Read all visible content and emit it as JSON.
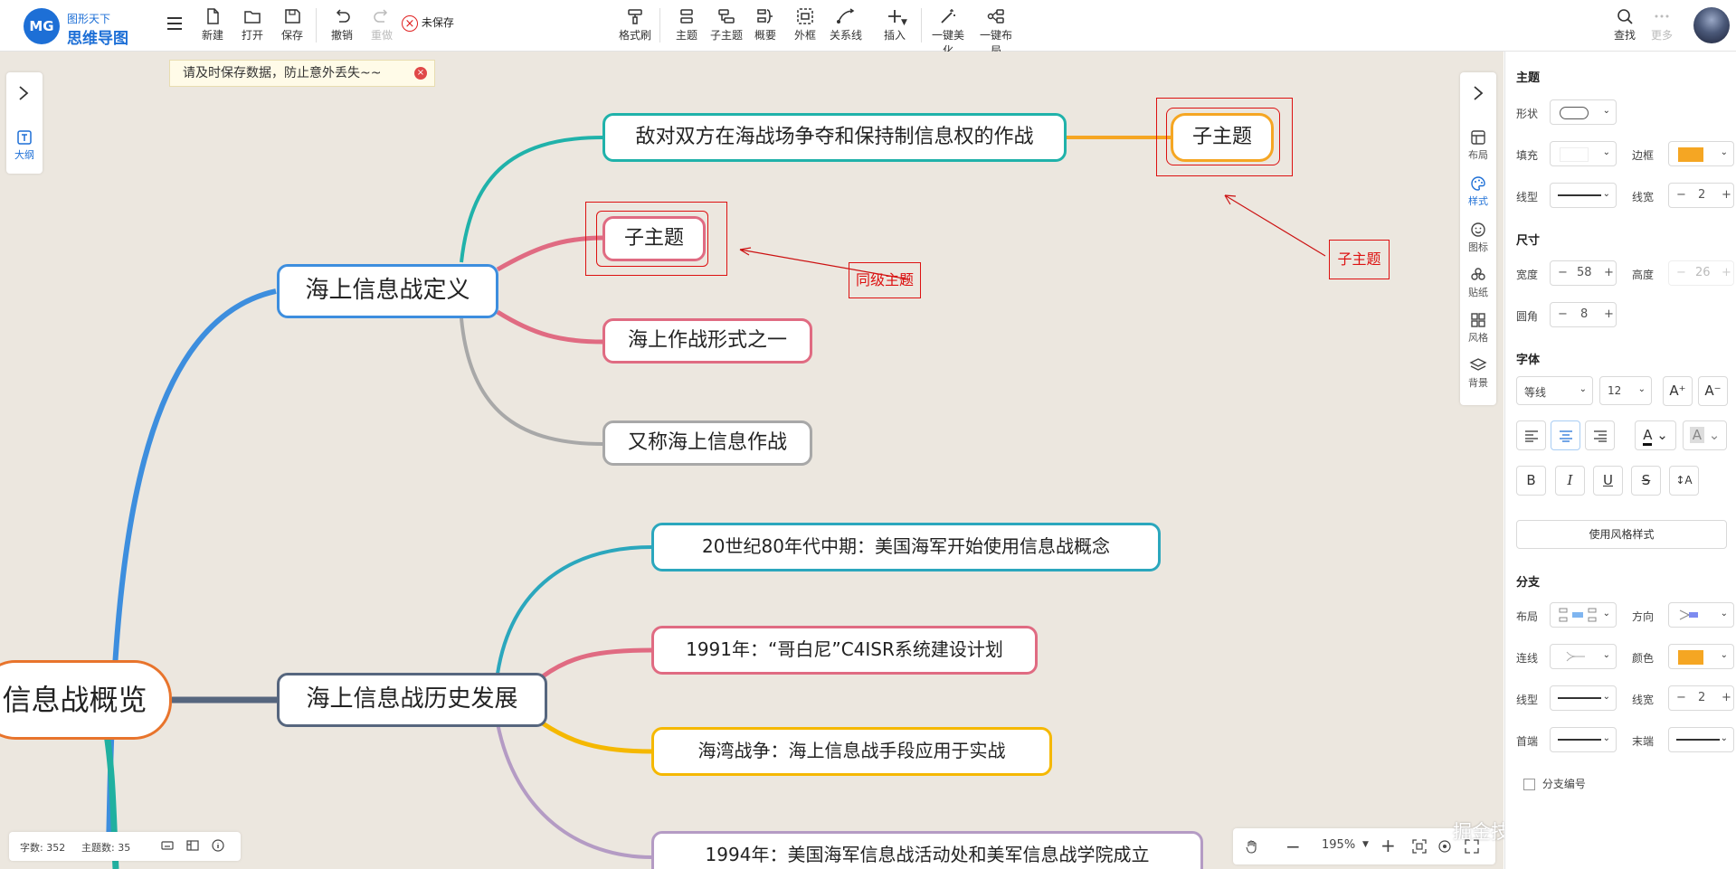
{
  "logo": {
    "mark": "MG",
    "line1": "图形天下",
    "line2": "思维导图"
  },
  "toolbar": {
    "menu_icon": "menu-icon",
    "new": "新建",
    "open": "打开",
    "save": "保存",
    "undo": "撤销",
    "redo": "重做",
    "unsaved": "未保存",
    "format_painter": "格式刷",
    "topic": "主题",
    "subtopic": "子主题",
    "summary": "概要",
    "boundary": "外框",
    "relation": "关系线",
    "insert": "插入",
    "beautify": "一键美化",
    "layout": "一键布局",
    "search": "查找",
    "more": "更多"
  },
  "toast": {
    "text": "请及时保存数据，防止意外丢失~~",
    "close": "×"
  },
  "left_panel": {
    "outline": "大纲"
  },
  "right_strip": {
    "layout": "布局",
    "style": "样式",
    "icon": "图标",
    "sticker": "贴纸",
    "theme": "风格",
    "background": "背景"
  },
  "mindmap": {
    "root": "信息战概览",
    "branch1": {
      "label": "海上信息战定义",
      "children": [
        "敌对双方在海战场争夺和保持制信息权的作战",
        "子主题",
        "海上作战形式之一",
        "又称海上信息作战"
      ],
      "grandchild": "子主题"
    },
    "branch2": {
      "label": "海上信息战历史发展",
      "children": [
        "20世纪80年代中期：美国海军开始使用信息战概念",
        "1991年：“哥白尼”C4ISR系统建设计划",
        "海湾战争：海上信息战手段应用于实战",
        "1994年：美国海军信息战活动处和美军信息战学院成立"
      ]
    }
  },
  "annotations": {
    "sibling": "同级主题",
    "child": "子主题"
  },
  "colors": {
    "accent": "#1d6fd6",
    "orange": "#f5a623",
    "teal": "#20b2aa",
    "pink": "#e06b82",
    "gray": "#a8a8a8",
    "annotation": "#dd1111"
  },
  "status": {
    "words": "字数: 352",
    "topics": "主题数: 35"
  },
  "zoom": {
    "level": "195%"
  },
  "watermark": "掘金技术社区 @ 图形天下",
  "panel": {
    "theme": {
      "title": "主题",
      "shape": "形状",
      "fill": "填充",
      "border": "边框",
      "line_type": "线型",
      "line_width": "线宽",
      "line_width_value": "2"
    },
    "size": {
      "title": "尺寸",
      "width": "宽度",
      "width_value": "58",
      "height": "高度",
      "height_value": "26",
      "radius": "圆角",
      "radius_value": "8"
    },
    "font": {
      "title": "字体",
      "family": "等线",
      "size": "12"
    },
    "use_style": "使用风格样式",
    "branch": {
      "title": "分支",
      "layout": "布局",
      "direction": "方向",
      "line": "连线",
      "color": "颜色",
      "line_type": "线型",
      "line_width": "线宽",
      "line_width_value": "2",
      "head": "首端",
      "tail": "末端",
      "numbering": "分支编号"
    }
  }
}
